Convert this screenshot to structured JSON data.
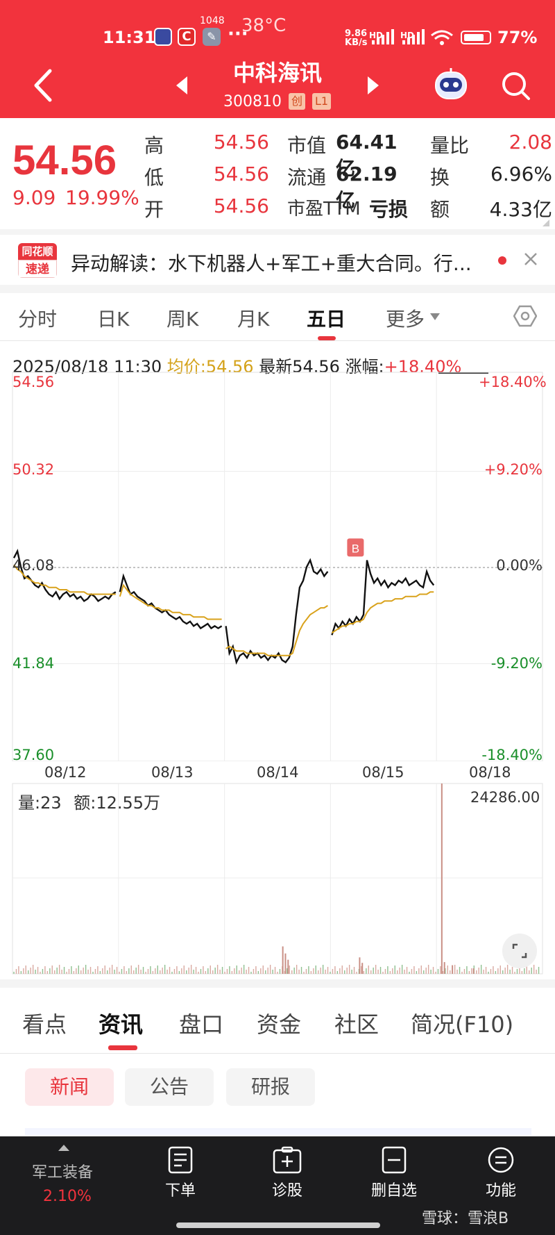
{
  "status_bar": {
    "time": "11:31",
    "notification_count": "1048",
    "temperature": "38°C",
    "net_speed_value": "9.86",
    "net_speed_unit": "KB/s",
    "sim_label": "HD",
    "battery": "77%",
    "battery_level": 0.77
  },
  "header": {
    "stock_name": "中科海讯",
    "stock_code": "300810",
    "board_badge": "创",
    "level_badge": "L1",
    "icons": [
      "back-icon",
      "prev-stock-icon",
      "next-stock-icon",
      "robot-assistant-icon",
      "search-icon"
    ]
  },
  "quote": {
    "price": "54.56",
    "change": "9.09",
    "change_pct": "19.99%",
    "rows": [
      {
        "label1": "高",
        "val1": "54.56",
        "label2": "市值",
        "val2": "64.41亿",
        "label3": "量比",
        "val3": "2.08"
      },
      {
        "label1": "低",
        "val1": "54.56",
        "label2": "流通",
        "val2": "62.19亿",
        "label3": "换",
        "val3": "6.96%"
      },
      {
        "label1": "开",
        "val1": "54.56",
        "label2": "市盈TTM",
        "val2": "亏损",
        "label3": "额",
        "val3": "4.33亿"
      }
    ]
  },
  "alert": {
    "logo_top": "同花顺",
    "logo_bottom": "速递",
    "text": "异动解读：水下机器人+军工+重大合同。行..."
  },
  "period_tabs": [
    "分时",
    "日K",
    "周K",
    "月K",
    "五日",
    "更多"
  ],
  "period_active": "五日",
  "chart_info": {
    "datetime": "2025/08/18 11:30",
    "avg_label": "均价:54.56",
    "latest_label": "最新54.56",
    "change_label": "涨幅:",
    "change_value": "+18.40%"
  },
  "chart_data": {
    "type": "line",
    "y_left_ticks": [
      "54.56",
      "50.32",
      "46.08",
      "41.84",
      "37.60"
    ],
    "y_right_ticks": [
      "+18.40%",
      "+9.20%",
      "0.00%",
      "-9.20%",
      "-18.40%"
    ],
    "x_ticks": [
      "08/12",
      "08/13",
      "08/14",
      "08/15",
      "08/18"
    ],
    "ylim": [
      37.6,
      54.56
    ],
    "prev_close": 46.08,
    "buy_marker": {
      "label": "B",
      "day": "08/15",
      "price": 46.5
    },
    "series": [
      {
        "name": "price",
        "color": "#111111",
        "segments": [
          [
            46.5,
            46.8,
            46.1,
            45.6,
            45.7,
            45.5,
            45.3,
            45.2,
            45.4,
            45.1,
            44.9,
            44.8,
            45.0,
            44.7,
            44.9,
            45.0,
            44.8,
            44.9,
            44.7,
            44.8,
            44.6,
            44.7,
            44.9,
            44.8,
            44.6,
            44.7,
            44.8,
            44.7,
            44.9,
            45.0
          ],
          [
            45.0,
            45.7,
            45.3,
            44.9,
            45.0,
            44.8,
            44.7,
            44.6,
            44.4,
            44.5,
            44.3,
            44.2,
            44.1,
            44.2,
            44.0,
            43.9,
            43.8,
            43.9,
            43.7,
            43.6,
            43.7,
            43.5,
            43.6,
            43.4,
            43.5,
            43.6,
            43.4,
            43.5,
            43.4,
            43.5
          ],
          [
            43.5,
            42.3,
            42.6,
            41.9,
            42.2,
            42.3,
            42.1,
            42.4,
            42.2,
            42.3,
            42.1,
            42.2,
            42.0,
            42.2,
            42.1,
            42.3,
            42.0,
            41.9,
            42.1,
            42.6,
            44.0,
            45.2,
            45.5,
            46.1,
            46.4,
            45.9,
            45.8,
            46.0,
            45.7,
            45.9
          ],
          [
            43.1,
            43.6,
            43.4,
            43.7,
            43.5,
            43.8,
            43.6,
            43.9,
            43.7,
            44.0,
            46.4,
            45.8,
            45.4,
            45.6,
            45.3,
            45.5,
            45.2,
            45.4,
            45.3,
            45.5,
            45.4,
            45.6,
            45.3,
            45.4,
            45.5,
            45.3,
            45.2,
            45.9,
            45.5,
            45.3
          ]
        ]
      },
      {
        "name": "avg",
        "color": "#d9a21b",
        "segments": [
          [
            46.2,
            46.0,
            45.9,
            45.7,
            45.6,
            45.5,
            45.4,
            45.4,
            45.3,
            45.3,
            45.2,
            45.2,
            45.2,
            45.1,
            45.1,
            45.1,
            45.0,
            45.0,
            45.0,
            45.0,
            45.0,
            44.9,
            44.9,
            44.9,
            44.9,
            44.9,
            44.9,
            44.9,
            44.9,
            44.9
          ],
          [
            44.8,
            45.3,
            45.1,
            44.9,
            44.8,
            44.7,
            44.6,
            44.5,
            44.4,
            44.4,
            44.3,
            44.3,
            44.2,
            44.2,
            44.2,
            44.1,
            44.1,
            44.1,
            44.0,
            44.0,
            44.0,
            43.9,
            43.9,
            43.9,
            43.9,
            43.8,
            43.8,
            43.8,
            43.8,
            43.8
          ],
          [
            42.5,
            42.6,
            42.5,
            42.4,
            42.4,
            42.4,
            42.3,
            42.3,
            42.3,
            42.3,
            42.3,
            42.3,
            42.2,
            42.2,
            42.2,
            42.2,
            42.2,
            42.2,
            42.2,
            42.3,
            42.8,
            43.3,
            43.6,
            43.8,
            44.0,
            44.1,
            44.2,
            44.3,
            44.3,
            44.4
          ],
          [
            43.2,
            43.3,
            43.4,
            43.5,
            43.5,
            43.6,
            43.6,
            43.7,
            43.7,
            43.8,
            44.1,
            44.3,
            44.4,
            44.5,
            44.5,
            44.6,
            44.6,
            44.6,
            44.7,
            44.7,
            44.7,
            44.8,
            44.8,
            44.8,
            44.8,
            44.9,
            44.9,
            44.9,
            45.0,
            45.0
          ]
        ]
      }
    ]
  },
  "volume": {
    "label": "量:23",
    "amount_label": "额:12.55万",
    "max_label": "24286.00",
    "max_value": 24286,
    "spikes": [
      {
        "pos": 0.51,
        "value": 3500
      },
      {
        "pos": 0.515,
        "value": 2600
      },
      {
        "pos": 0.52,
        "value": 1800
      },
      {
        "pos": 0.655,
        "value": 2100
      },
      {
        "pos": 0.66,
        "value": 1400
      },
      {
        "pos": 0.81,
        "value": 24286
      },
      {
        "pos": 0.815,
        "value": 1500
      },
      {
        "pos": 0.83,
        "value": 1100
      },
      {
        "pos": 0.87,
        "value": 700
      }
    ]
  },
  "content_tabs": [
    "看点",
    "资讯",
    "盘口",
    "资金",
    "社区",
    "简况(F10)"
  ],
  "content_active": "资讯",
  "sub_tabs": [
    "新闻",
    "公告",
    "研报"
  ],
  "sub_active": "新闻",
  "bottom_bar": {
    "sector_name": "军工装备",
    "sector_pct": "2.10%",
    "items": [
      {
        "label": "下单",
        "icon": "order-icon"
      },
      {
        "label": "诊股",
        "icon": "diagnose-icon"
      },
      {
        "label": "删自选",
        "icon": "remove-watchlist-icon"
      },
      {
        "label": "功能",
        "icon": "menu-icon"
      }
    ],
    "watermark": "雪球：雪浪B"
  },
  "colors": {
    "brand_red": "#f2333d",
    "up_red": "#e8353d",
    "down_green": "#1a8f2a",
    "avg_yellow": "#d9a21b",
    "volume_bar": "#c9a08a"
  }
}
